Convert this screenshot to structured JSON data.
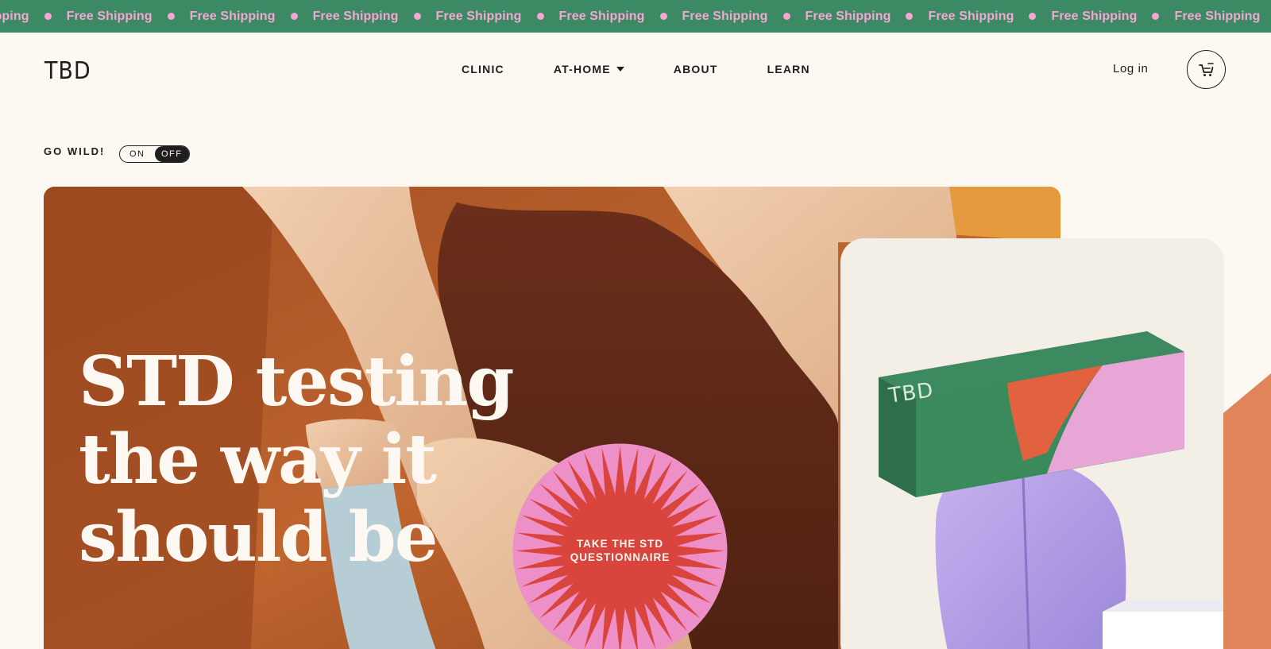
{
  "colors": {
    "marquee_bg": "#3c8a64",
    "marquee_text": "#f4a6d4",
    "page_bg": "#fdf8f1",
    "burst_pink": "#ee90c8",
    "burst_red": "#d9453c"
  },
  "marquee": {
    "partial_first": "ipping",
    "item": "Free Shipping",
    "repeat": 10
  },
  "header": {
    "logo": "TBD",
    "nav": [
      {
        "label": "CLINIC"
      },
      {
        "label": "AT-HOME",
        "dropdown": true
      },
      {
        "label": "ABOUT"
      },
      {
        "label": "LEARN"
      }
    ],
    "login": "Log in",
    "cart_icon": "cart-icon"
  },
  "toggle": {
    "label": "GO WILD!",
    "on": "ON",
    "off": "OFF",
    "state": "OFF"
  },
  "hero": {
    "title_lines": [
      "STD testing",
      "the way it",
      "should be"
    ],
    "cta_line1": "TAKE THE STD",
    "cta_line2": "QUESTIONNAIRE"
  },
  "product": {
    "box_logo": "TBD"
  }
}
